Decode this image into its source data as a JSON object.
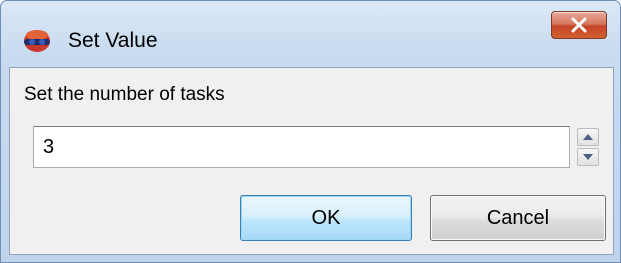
{
  "window": {
    "title": "Set Value",
    "app_icon": "app-icon",
    "close_icon": "close-icon"
  },
  "dialog": {
    "prompt": "Set the number of tasks",
    "spinner": {
      "value": "3",
      "up_icon": "arrow-up-icon",
      "down_icon": "arrow-down-icon"
    },
    "buttons": {
      "ok_label": "OK",
      "cancel_label": "Cancel"
    }
  },
  "colors": {
    "close_button": "#c6452a",
    "ok_button_border": "#3c7fb1",
    "frame": "#bfd3ec"
  }
}
